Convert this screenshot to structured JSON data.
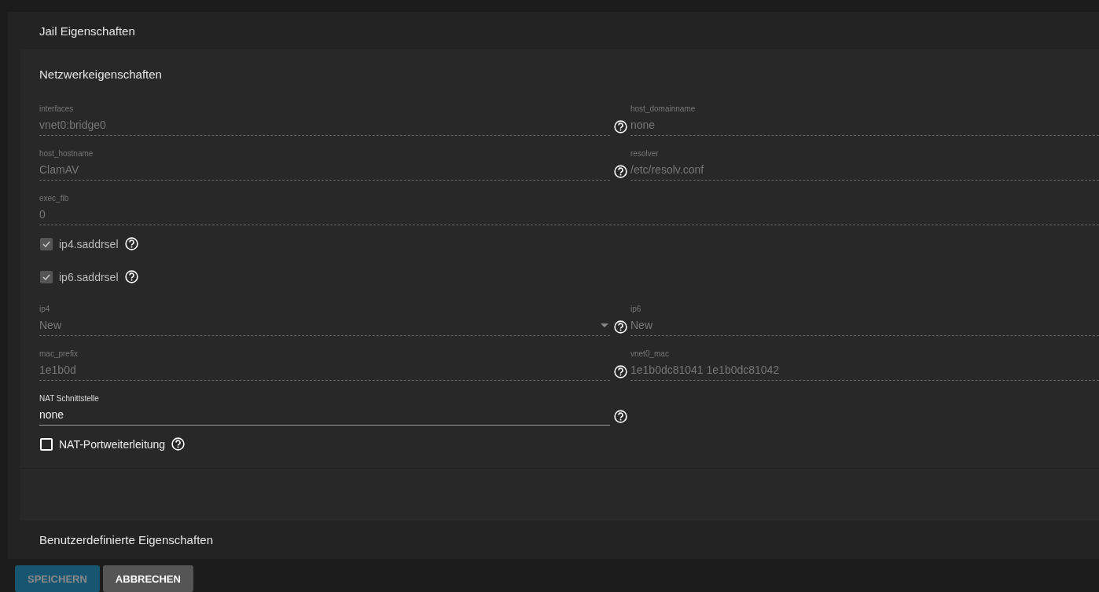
{
  "panel_title": "Jail Eigenschaften",
  "section_title": "Netzwerkeigenschaften",
  "rows": [
    {
      "kind": "pair",
      "fields": [
        {
          "label": "interfaces",
          "value": "vnet0:bridge0",
          "disabled": true,
          "help": true
        },
        {
          "label": "host_domainname",
          "value": "none",
          "disabled": true,
          "help": false
        }
      ]
    },
    {
      "kind": "pair",
      "fields": [
        {
          "label": "host_hostname",
          "value": "ClamAV",
          "disabled": true,
          "help": true
        },
        {
          "label": "resolver",
          "value": "/etc/resolv.conf",
          "disabled": true,
          "help": false
        }
      ]
    },
    {
      "kind": "wide",
      "fields": [
        {
          "label": "exec_fib",
          "value": "0",
          "disabled": true,
          "help": false
        }
      ]
    },
    {
      "kind": "checkbox",
      "label": "ip4.saddrsel",
      "checked": true,
      "disabled": true,
      "help": true
    },
    {
      "kind": "checkbox",
      "label": "ip6.saddrsel",
      "checked": true,
      "disabled": true,
      "help": true
    },
    {
      "kind": "pair",
      "fields": [
        {
          "label": "ip4",
          "value": "New",
          "disabled": true,
          "help": true,
          "dropdown": true
        },
        {
          "label": "ip6",
          "value": "New",
          "disabled": true,
          "help": false
        }
      ]
    },
    {
      "kind": "pair",
      "fields": [
        {
          "label": "mac_prefix",
          "value": "1e1b0d",
          "disabled": true,
          "help": true
        },
        {
          "label": "vnet0_mac",
          "value": "1e1b0dc81041 1e1b0dc81042",
          "disabled": true,
          "help": false
        }
      ]
    },
    {
      "kind": "half",
      "fields": [
        {
          "label": "NAT Schnittstelle",
          "value": "none",
          "disabled": false,
          "help": true
        }
      ]
    },
    {
      "kind": "checkbox",
      "label": "NAT-Portweiterleitung",
      "checked": false,
      "disabled": false,
      "help": true
    }
  ],
  "collapsed_title": "Benutzerdefinierte Eigenschaften",
  "buttons": [
    {
      "label": "SPEICHERN",
      "kind": "primary",
      "disabled": true
    },
    {
      "label": "ABBRECHEN",
      "kind": "secondary",
      "disabled": false
    }
  ]
}
